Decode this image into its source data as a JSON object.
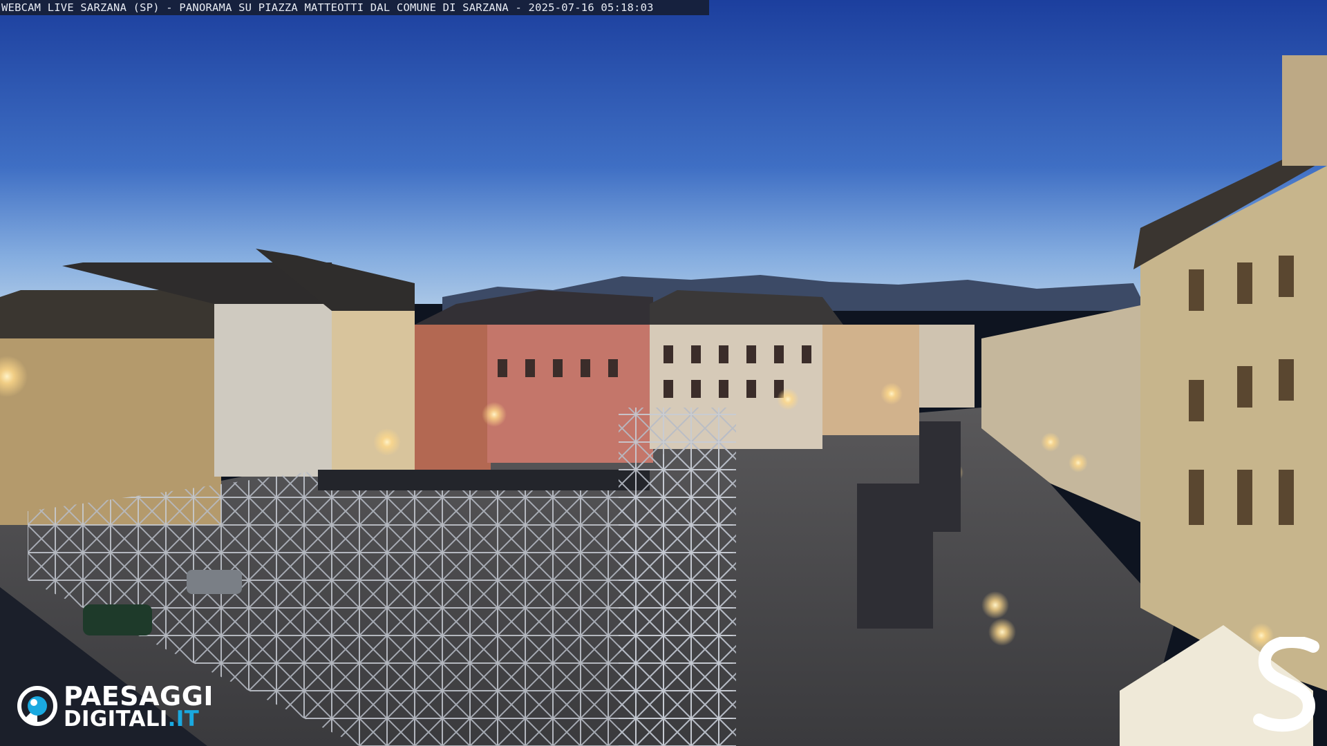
{
  "overlay": {
    "caption": "WEBCAM LIVE SARZANA (SP) - PANORAMA SU PIAZZA MATTEOTTI DAL COMUNE DI SARZANA - 2025-07-16  05:18:03"
  },
  "logo": {
    "line1": "PAESAGGI",
    "line2_main": "DIGITALI",
    "line2_tld": ".IT",
    "icon": "camera-eye-icon",
    "accent_color": "#1aa9e0"
  },
  "watermark": {
    "icon": "s-letter-mark"
  },
  "colors": {
    "sky_top": "#1c3f9e",
    "sky_horizon": "#9fc0e4",
    "pavement": "#4a4a4e",
    "lamp_glow": "#ffd98a"
  }
}
